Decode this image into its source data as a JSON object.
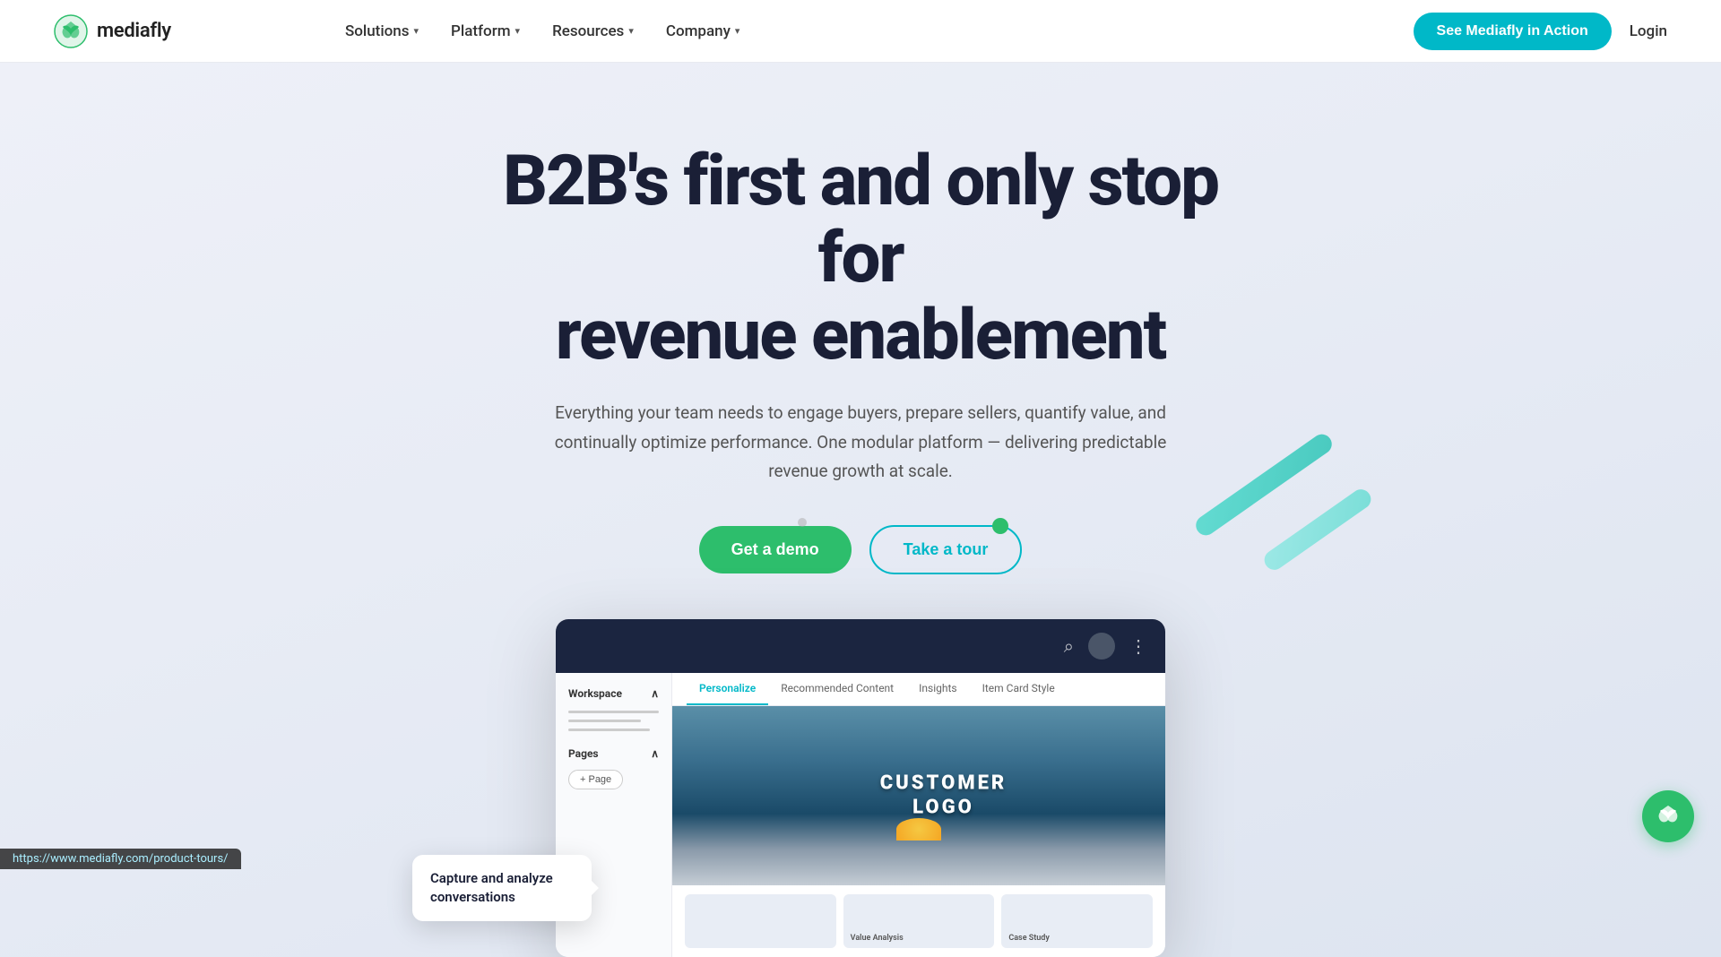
{
  "nav": {
    "logo_text": "mediafly",
    "links": [
      {
        "label": "Solutions",
        "has_dropdown": true
      },
      {
        "label": "Platform",
        "has_dropdown": true
      },
      {
        "label": "Resources",
        "has_dropdown": true
      },
      {
        "label": "Company",
        "has_dropdown": true
      }
    ],
    "cta_label": "See Mediafly in Action",
    "login_label": "Login"
  },
  "hero": {
    "title_line1": "B2B's first and only stop for",
    "title_line2": "revenue enablement",
    "subtitle": "Everything your team needs to engage buyers, prepare sellers, quantify value, and continually optimize performance. One modular platform — delivering predictable revenue growth at scale.",
    "demo_button": "Get a demo",
    "tour_button": "Take a tour"
  },
  "mockup": {
    "sidebar": {
      "workspace_label": "Workspace",
      "pages_label": "Pages",
      "add_page_btn": "+ Page"
    },
    "tabs": [
      {
        "label": "Personalize",
        "active": true
      },
      {
        "label": "Recommended Content",
        "active": false
      },
      {
        "label": "Insights",
        "active": false
      },
      {
        "label": "Item Card Style",
        "active": false
      }
    ],
    "customer_logo_line1": "CUSTOMER",
    "customer_logo_line2": "LOGO",
    "bottom_cards": [
      {
        "label": ""
      },
      {
        "label": "Value Analysis"
      },
      {
        "label": "Case Study"
      }
    ]
  },
  "tooltip": {
    "text": "Capture and analyze conversations"
  },
  "floating_icon": {
    "label": "mediafly-chat-icon"
  },
  "url_bar": {
    "url": "https://www.mediafly.com/product-tours/"
  }
}
